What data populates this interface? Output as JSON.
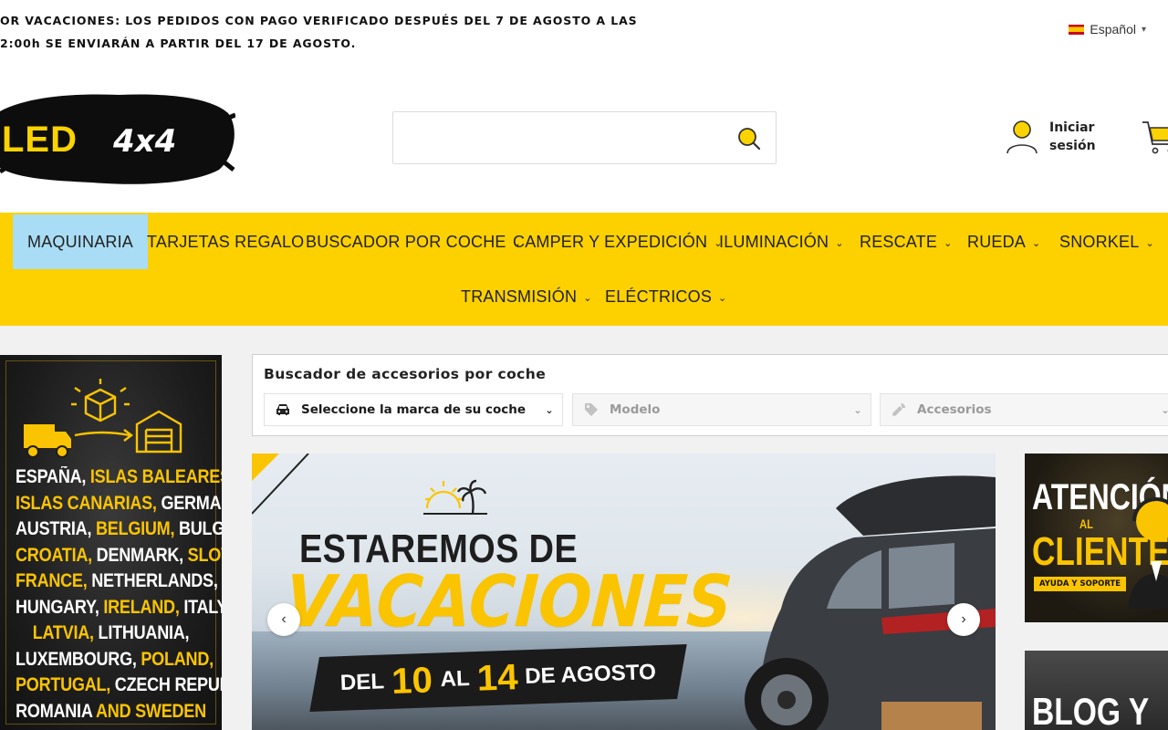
{
  "announcement": {
    "line1": "OR VACACIONES: LOS PEDIDOS CON PAGO VERIFICADO DESPUÉS DEL 7 DE AGOSTO A LAS",
    "line2": "2:00h SE ENVIARÁN A PARTIR DEL 17 DE AGOSTO."
  },
  "language": {
    "label": "Español"
  },
  "logo": {
    "text": "LED4x4"
  },
  "search": {
    "value": "",
    "placeholder": ""
  },
  "account": {
    "login_label": "Iniciar sesión"
  },
  "nav": {
    "items": [
      {
        "label": "MAQUINARIA",
        "has_dropdown": false,
        "active": true
      },
      {
        "label": "TARJETAS REGALO",
        "has_dropdown": false
      },
      {
        "label": "BUSCADOR POR COCHE",
        "has_dropdown": true
      },
      {
        "label": "CAMPER Y EXPEDICIÓN",
        "has_dropdown": true
      },
      {
        "label": "ILUMINACIÓN",
        "has_dropdown": true
      },
      {
        "label": "RESCATE",
        "has_dropdown": true
      },
      {
        "label": "RUEDA",
        "has_dropdown": true
      },
      {
        "label": "SNORKEL",
        "has_dropdown": true
      },
      {
        "label": "TRANSMISIÓN",
        "has_dropdown": true
      },
      {
        "label": "ELÉCTRICOS",
        "has_dropdown": true
      }
    ],
    "active_color": "#a9dcf5",
    "bar_color": "#fdd000"
  },
  "shipping_banner": {
    "lines": [
      [
        {
          "t": "ESPAÑA, ",
          "y": false
        },
        {
          "t": "ISLAS BALEARES,",
          "y": true
        }
      ],
      [
        {
          "t": "ISLAS CANARIAS,",
          "y": true
        },
        {
          "t": " GERMANY",
          "y": false
        }
      ],
      [
        {
          "t": "AUSTRIA, ",
          "y": false
        },
        {
          "t": "BELGIUM,",
          "y": true
        },
        {
          "t": " BULGARIA",
          "y": false
        }
      ],
      [
        {
          "t": "CROATIA,",
          "y": true
        },
        {
          "t": " DENMARK, ",
          "y": false
        },
        {
          "t": "SLOVAKIA,",
          "y": true
        }
      ],
      [
        {
          "t": "FRANCE,",
          "y": true
        },
        {
          "t": " NETHERLANDS,",
          "y": false
        }
      ],
      [
        {
          "t": "HUNGARY, ",
          "y": false
        },
        {
          "t": "IRELAND,",
          "y": true
        },
        {
          "t": " ITALY",
          "y": false
        }
      ],
      [
        {
          "t": "LATVIA,",
          "y": true
        },
        {
          "t": " LITHUANIA,",
          "y": false
        }
      ],
      [
        {
          "t": "LUXEMBOURG, ",
          "y": false
        },
        {
          "t": "POLAND,",
          "y": true
        }
      ],
      [
        {
          "t": "PORTUGAL,",
          "y": true
        },
        {
          "t": " CZECH REPUBLIC",
          "y": false
        }
      ],
      [
        {
          "t": "ROMANIA ",
          "y": false
        },
        {
          "t": "AND SWEDEN",
          "y": true
        }
      ]
    ]
  },
  "finder": {
    "title": "Buscador de accesorios por coche",
    "brand_select": "Seleccione la marca de su coche",
    "model_select": "Modelo",
    "accessories_select": "Accesorios"
  },
  "slider": {
    "title": "ESTAREMOS DE",
    "big_word": "VACACIONES",
    "dates": {
      "del": "DEL",
      "from": "10",
      "al": "AL",
      "to": "14",
      "month": "DE AGOSTO"
    }
  },
  "promos": {
    "support": {
      "title_1": "ATENCIÓN",
      "title_2": "AL",
      "title_3": "CLIENTE",
      "subtitle": "AYUDA Y SOPORTE"
    },
    "blog": {
      "title": "BLOG Y"
    }
  },
  "icons": {
    "search": "search-icon",
    "user": "user-icon",
    "cart": "cart-icon",
    "car": "car-icon",
    "tag": "tag-icon",
    "wrench": "wrench-icon"
  },
  "colors": {
    "brand_yellow": "#fdd000",
    "accent_yellow": "#fbc400"
  }
}
